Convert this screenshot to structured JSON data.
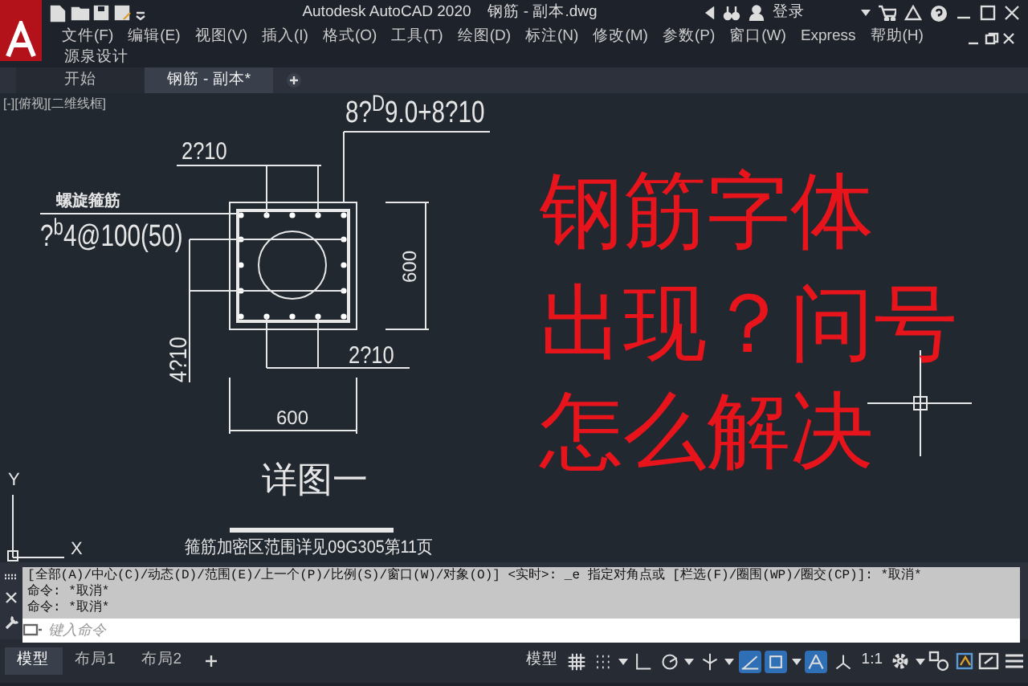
{
  "title_bar": {
    "app_title": "Autodesk AutoCAD 2020",
    "file_title": "钢筋 - 副本.dwg",
    "sign_in": "登录"
  },
  "menu": [
    {
      "label": "文件(F)"
    },
    {
      "label": "编辑(E)"
    },
    {
      "label": "视图(V)"
    },
    {
      "label": "插入(I)"
    },
    {
      "label": "格式(O)"
    },
    {
      "label": "工具(T)"
    },
    {
      "label": "绘图(D)"
    },
    {
      "label": "标注(N)"
    },
    {
      "label": "修改(M)"
    },
    {
      "label": "参数(P)"
    },
    {
      "label": "窗口(W)"
    },
    {
      "label": "Express"
    },
    {
      "label": "帮助(H)"
    },
    {
      "label": "源泉设计"
    }
  ],
  "file_tabs": [
    {
      "label": "开始",
      "selected": false
    },
    {
      "label": "钢筋 - 副本*",
      "selected": true
    }
  ],
  "viewport_label": "[-][俯视][二维线框]",
  "drawing": {
    "top_rebar_spec": "8?$^{D}$9.0+8?10",
    "top_bar_note": "2?10",
    "spiral_label": "螺旋箍筋",
    "spiral_spec": "?$^{b}$4@100(50)",
    "right_dimension": "600",
    "side_bar_note": "4?10",
    "bottom_bar_note": "2?10",
    "bottom_dimension": "600",
    "detail_title": "详图一",
    "footnote": "箍筋加密区范围详见09G305第11页",
    "ucs_y": "Y",
    "ucs_x": "X"
  },
  "overlay_caption": [
    "钢筋字体",
    "出现？问号",
    "怎么解决"
  ],
  "command_history": [
    "[全部(A)/中心(C)/动态(D)/范围(E)/上一个(P)/比例(S)/窗口(W)/对象(O)] <实时>: _e 指定对角点或 [栏选(F)/圈围(WP)/圈交(CP)]: *取消*",
    "命令: *取消*",
    "命令: *取消*"
  ],
  "command_input": {
    "placeholder": "键入命令"
  },
  "layout_tabs": [
    {
      "label": "模型",
      "selected": true
    },
    {
      "label": "布局1",
      "selected": false
    },
    {
      "label": "布局2",
      "selected": false
    }
  ],
  "status_bar": {
    "model_button": "模型",
    "scale": "1:1"
  },
  "status_toggles": [
    {
      "kind": "grid",
      "on": false
    },
    {
      "kind": "snap",
      "on": false
    },
    {
      "kind": "ortho",
      "on": false
    },
    {
      "kind": "polar",
      "on": false
    },
    {
      "kind": "isodraft",
      "on": false
    },
    {
      "kind": "tracking",
      "on": true
    },
    {
      "kind": "osnap",
      "on": true
    },
    {
      "kind": "annotation",
      "on": true
    },
    {
      "kind": "annoscale",
      "on": false
    }
  ]
}
